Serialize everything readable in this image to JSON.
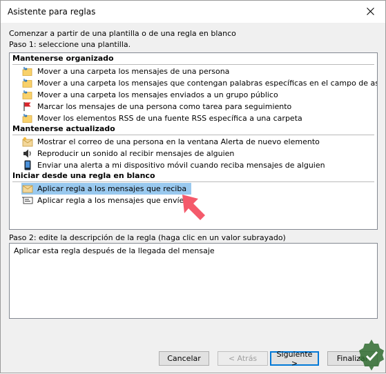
{
  "window": {
    "title": "Asistente para reglas"
  },
  "intro": "Comenzar a partir de una plantilla o de una regla en blanco",
  "step1": "Paso 1: seleccione una plantilla.",
  "groups": [
    {
      "header": "Mantenerse organizado",
      "items": [
        {
          "label": "Mover a una carpeta los mensajes de una persona",
          "icon": "folder-move-icon"
        },
        {
          "label": "Mover a una carpeta los mensajes que contengan palabras específicas en el campo de asunto",
          "icon": "folder-move-icon"
        },
        {
          "label": "Mover a una carpeta los mensajes enviados a un grupo público",
          "icon": "folder-move-icon"
        },
        {
          "label": "Marcar los mensajes de una persona como tarea para seguimiento",
          "icon": "red-flag-icon"
        },
        {
          "label": "Mover los elementos RSS de una fuente RSS específica a una carpeta",
          "icon": "folder-move-icon"
        }
      ]
    },
    {
      "header": "Mantenerse actualizado",
      "items": [
        {
          "label": "Mostrar el correo de una persona en la ventana Alerta de nuevo elemento",
          "icon": "envelope-alert-icon"
        },
        {
          "label": "Reproducir un sonido al recibir mensajes de alguien",
          "icon": "speaker-icon"
        },
        {
          "label": "Enviar una alerta a mi dispositivo móvil cuando reciba mensajes de alguien",
          "icon": "mobile-device-icon"
        }
      ]
    },
    {
      "header": "Iniciar desde una regla en blanco",
      "items": [
        {
          "label": "Aplicar regla a los mensajes que reciba",
          "icon": "envelope-icon",
          "selected": true
        },
        {
          "label": "Aplicar regla a los mensajes que envíe",
          "icon": "outgoing-mail-icon"
        }
      ]
    }
  ],
  "step2": "Paso 2: edite la descripción de la regla (haga clic en un valor subrayado)",
  "description": "Aplicar esta regla después de la llegada del mensaje",
  "buttons": {
    "cancel": "Cancelar",
    "back": "< Atrás",
    "next": "Siguiente >",
    "finish": "Finalizar"
  },
  "colors": {
    "selection": "#99c9ef",
    "annotation_arrow": "#f45a6b",
    "default_button_border": "#0078d7"
  }
}
